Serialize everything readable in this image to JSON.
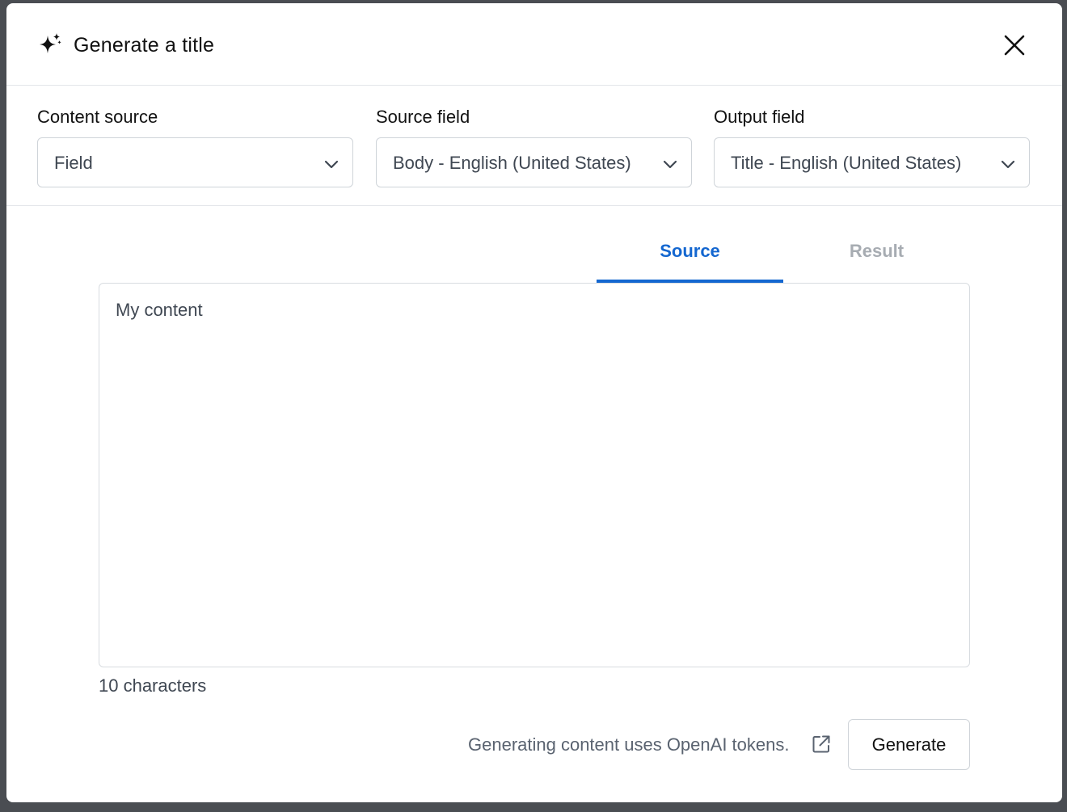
{
  "dialog": {
    "title": "Generate a title",
    "header_icon": "sparkle-icon",
    "close_icon": "close-icon"
  },
  "fields": {
    "content_source": {
      "label": "Content source",
      "value": "Field"
    },
    "source_field": {
      "label": "Source field",
      "value": "Body - English (United States)"
    },
    "output_field": {
      "label": "Output field",
      "value": "Title - English (United States)"
    },
    "chevron_icon": "chevron-down-icon"
  },
  "tabs": [
    {
      "label": "Source",
      "active": true
    },
    {
      "label": "Result",
      "active": false
    }
  ],
  "content": {
    "text": "My content",
    "char_count": "10 characters"
  },
  "footer": {
    "note": "Generating content uses OpenAI tokens.",
    "note_icon": "external-link-icon",
    "generate_label": "Generate"
  },
  "colors": {
    "accent": "#1467d0",
    "inactive_tab": "#a7acb2",
    "backdrop": "#4a4d52"
  }
}
